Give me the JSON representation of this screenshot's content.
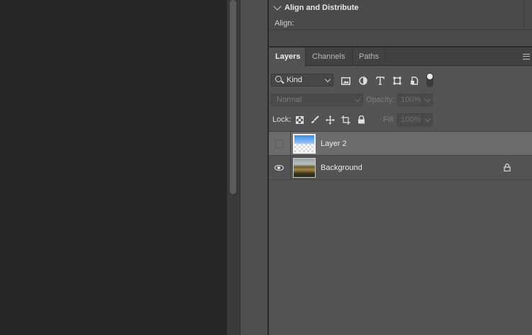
{
  "properties_panel": {
    "section_title": "Align and Distribute",
    "align_label": "Align:"
  },
  "layers_panel": {
    "tabs": [
      {
        "label": "Layers",
        "active": true
      },
      {
        "label": "Channels",
        "active": false
      },
      {
        "label": "Paths",
        "active": false
      }
    ],
    "filter": {
      "kind_value": "Kind",
      "icons": [
        "pixel-filter-icon",
        "adjustment-filter-icon",
        "type-filter-icon",
        "shape-filter-icon",
        "smart-object-filter-icon"
      ],
      "filter_toggle_on": true
    },
    "blend_mode": "Normal",
    "opacity_label": "Opacity:",
    "opacity_value": "100%",
    "lock_label": "Lock:",
    "lock_icons": [
      "lock-transparent-pixels-icon",
      "lock-image-pixels-icon",
      "lock-position-icon",
      "lock-artboard-icon",
      "lock-all-icon"
    ],
    "fill_label": "Fill:",
    "fill_value": "100%",
    "layers": [
      {
        "name": "Layer 2",
        "visible": false,
        "selected": true,
        "locked": false
      },
      {
        "name": "Background",
        "visible": true,
        "selected": false,
        "locked": true
      }
    ]
  }
}
